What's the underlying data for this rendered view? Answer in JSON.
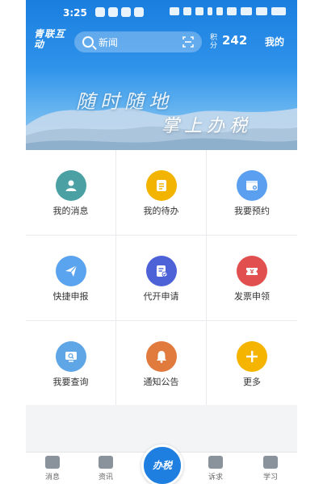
{
  "status_bar": {
    "time": "3:25"
  },
  "app": {
    "logo_text": "青联互动"
  },
  "search": {
    "placeholder": "新闻"
  },
  "points": {
    "label": "积分",
    "value": "242"
  },
  "me_label": "我的",
  "banner": {
    "line1": "随时随地",
    "line2": "掌上办税"
  },
  "grid": [
    {
      "label": "我的消息",
      "icon": "person-icon",
      "color": "#4aa0a3"
    },
    {
      "label": "我的待办",
      "icon": "todo-icon",
      "color": "#f2b400"
    },
    {
      "label": "我要预约",
      "icon": "calendar-icon",
      "color": "#5b9ff0"
    },
    {
      "label": "快捷申报",
      "icon": "paper-plane-icon",
      "color": "#5aa3ef"
    },
    {
      "label": "代开申请",
      "icon": "document-check-icon",
      "color": "#4e62d8"
    },
    {
      "label": "发票申领",
      "icon": "ticket-icon",
      "color": "#e14f4f"
    },
    {
      "label": "我要查询",
      "icon": "query-icon",
      "color": "#5ea6e6"
    },
    {
      "label": "通知公告",
      "icon": "bell-icon",
      "color": "#e07a3d"
    },
    {
      "label": "更多",
      "icon": "plus-icon",
      "color": "#f4b400"
    }
  ],
  "bottom_nav": [
    {
      "label": "消息",
      "icon": "message-icon"
    },
    {
      "label": "资讯",
      "icon": "news-icon"
    },
    {
      "label": "办税",
      "icon": "tax-icon"
    },
    {
      "label": "诉求",
      "icon": "edit-icon"
    },
    {
      "label": "学习",
      "icon": "study-icon"
    }
  ]
}
